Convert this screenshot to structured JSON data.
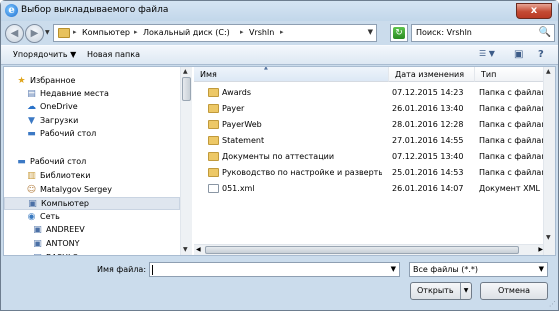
{
  "window": {
    "title": "Выбор выкладываемого файла",
    "close_label": "x",
    "app_icon_glyph": "e"
  },
  "nav_buttons": {
    "back": "◀",
    "forward": "▶",
    "dropdown": "▼"
  },
  "address": {
    "crumbs": [
      "Компьютер",
      "Локальный диск (C:)",
      "Vrshln"
    ],
    "separator": "▸",
    "dropdown": "▼"
  },
  "refresh_glyph": "↻",
  "search": {
    "value": "Поиск: Vrshln",
    "icon": "🔍"
  },
  "toolbar": {
    "organize_label": "Упорядочить ▼",
    "new_folder_label": "Новая папка",
    "view_glyph": "☰ ▼",
    "preview_glyph": "▣",
    "help_glyph": "?"
  },
  "navigation": [
    {
      "label": "Избранное",
      "icon": "★",
      "color": "#e0a51c",
      "indent": 0
    },
    {
      "label": "Недавние места",
      "icon": "▤",
      "color": "#5a7bb0",
      "indent": 1
    },
    {
      "label": "OneDrive",
      "icon": "☁",
      "color": "#2a72c8",
      "indent": 1
    },
    {
      "label": "Загрузки",
      "icon": "▼",
      "color": "#3c79c4",
      "indent": 1
    },
    {
      "label": "Рабочий стол",
      "icon": "▬",
      "color": "#3c79c4",
      "indent": 1
    },
    {
      "label": "Рабочий стол",
      "icon": "▬",
      "color": "#3c79c4",
      "indent": 0
    },
    {
      "label": "Библиотеки",
      "icon": "▥",
      "color": "#c89a3a",
      "indent": 1
    },
    {
      "label": "Matalygov Sergey",
      "icon": "☺",
      "color": "#b07a3a",
      "indent": 1
    },
    {
      "label": "Компьютер",
      "icon": "▣",
      "color": "#4a6fa5",
      "indent": 1,
      "selected": true
    },
    {
      "label": "Сеть",
      "icon": "◉",
      "color": "#3a7ac0",
      "indent": 1
    },
    {
      "label": "ANDREEV",
      "icon": "▣",
      "color": "#4a6fa5",
      "indent": 2
    },
    {
      "label": "ANTONY",
      "icon": "▣",
      "color": "#4a6fa5",
      "indent": 2
    },
    {
      "label": "BASHLO",
      "icon": "▣",
      "color": "#4a6fa5",
      "indent": 2
    }
  ],
  "columns": {
    "name": "Имя",
    "date": "Дата изменения",
    "type": "Тип",
    "sort_caret": "▲"
  },
  "files": [
    {
      "name": "Awards",
      "date": "07.12.2015 14:23",
      "type": "Папка с файлами",
      "kind": "folder"
    },
    {
      "name": "Payer",
      "date": "26.01.2016 13:40",
      "type": "Папка с файлами",
      "kind": "folder"
    },
    {
      "name": "PayerWeb",
      "date": "28.01.2016 12:28",
      "type": "Папка с файлами",
      "kind": "folder"
    },
    {
      "name": "Statement",
      "date": "27.01.2016 14:55",
      "type": "Папка с файлами",
      "kind": "folder"
    },
    {
      "name": "Документы по аттестации",
      "date": "07.12.2015 13:40",
      "type": "Папка с файлами",
      "kind": "folder"
    },
    {
      "name": "Руководство по настройке и развертыван...",
      "date": "25.01.2016 14:53",
      "type": "Папка с файлами",
      "kind": "folder"
    },
    {
      "name": "051.xml",
      "date": "26.01.2016 14:07",
      "type": "Документ XML",
      "kind": "xml"
    }
  ],
  "scroll_arrows": {
    "up": "▲",
    "down": "▼",
    "left": "◀",
    "right": "▶"
  },
  "bottom": {
    "filename_label": "Имя файла:",
    "filename_value": "",
    "filter_value": "Все файлы (*.*)",
    "dropdown": "▼",
    "open_label": "Открыть",
    "open_split": "▼",
    "cancel_label": "Отмена",
    "grip": "⋰"
  }
}
